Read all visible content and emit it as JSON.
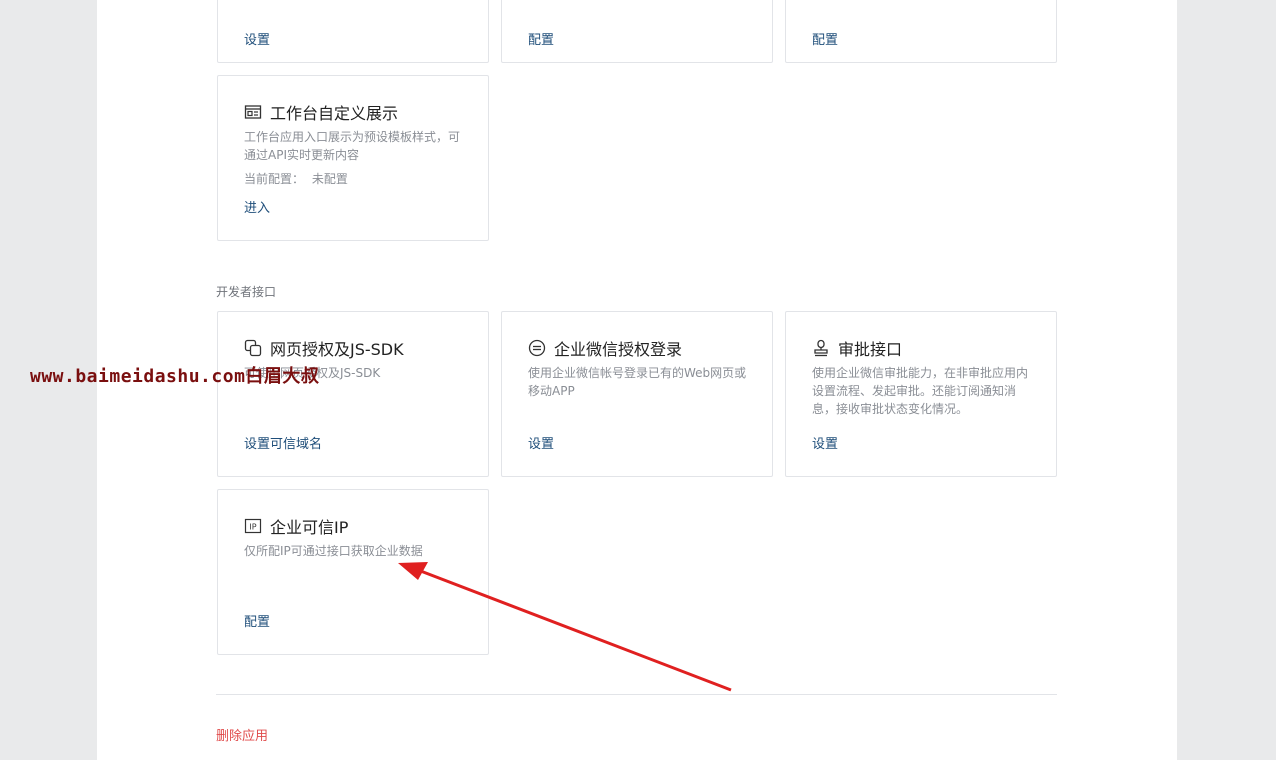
{
  "top_row": [
    {
      "link": "设置"
    },
    {
      "link": "配置"
    },
    {
      "link": "配置"
    }
  ],
  "workbench": {
    "title": "工作台自定义展示",
    "icon": "workbench-display-icon",
    "description": "工作台应用入口展示为预设模板样式，可通过API实时更新内容",
    "config_label": "当前配置：",
    "config_value": "未配置",
    "link": "进入"
  },
  "section": {
    "title": "开发者接口"
  },
  "api_cards": [
    {
      "title": "网页授权及JS-SDK",
      "icon": "copy-squares-icon",
      "description": "可使用网页授权及JS-SDK",
      "link": "设置可信域名"
    },
    {
      "title": "企业微信授权登录",
      "icon": "circle-lines-icon",
      "description": "使用企业微信帐号登录已有的Web网页或移动APP",
      "link": "设置"
    },
    {
      "title": "审批接口",
      "icon": "stamp-icon",
      "description": "使用企业微信审批能力，在非审批应用内设置流程、发起审批。还能订阅通知消息，接收审批状态变化情况。",
      "link": "设置"
    }
  ],
  "trusted_ip": {
    "title": "企业可信IP",
    "icon": "ip-icon",
    "description": "仅所配IP可通过接口获取企业数据",
    "link": "配置"
  },
  "delete": {
    "label": "删除应用"
  },
  "watermark": {
    "text": "www.baimeidashu.com白眉大叔"
  },
  "colors": {
    "link": "#1f4e7a",
    "danger": "#e04b4b",
    "arrow": "#e02020",
    "watermark": "#7a0f0f"
  }
}
